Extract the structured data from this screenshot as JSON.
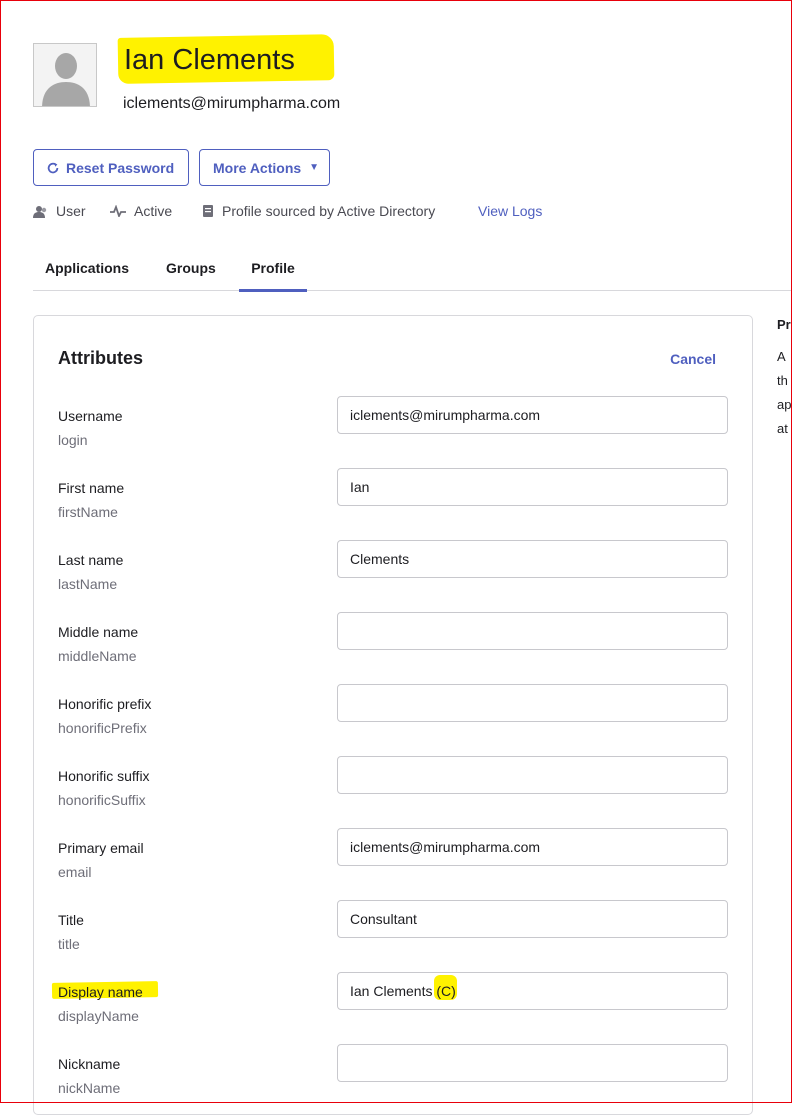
{
  "user": {
    "name": "Ian Clements",
    "email": "iclements@mirumpharma.com"
  },
  "actions": {
    "reset_password": "Reset Password",
    "more_actions": "More Actions",
    "more_caret": "▼"
  },
  "status": {
    "type": "User",
    "state": "Active",
    "source": "Profile sourced by Active Directory",
    "view_logs": "View Logs"
  },
  "tabs": [
    {
      "label": "Applications"
    },
    {
      "label": "Groups"
    },
    {
      "label": "Profile",
      "active": true
    }
  ],
  "attributes": {
    "title": "Attributes",
    "cancel": "Cancel",
    "fields": [
      {
        "label": "Username",
        "key": "login",
        "value": "iclements@mirumpharma.com"
      },
      {
        "label": "First name",
        "key": "firstName",
        "value": "Ian"
      },
      {
        "label": "Last name",
        "key": "lastName",
        "value": "Clements"
      },
      {
        "label": "Middle name",
        "key": "middleName",
        "value": ""
      },
      {
        "label": "Honorific prefix",
        "key": "honorificPrefix",
        "value": ""
      },
      {
        "label": "Honorific suffix",
        "key": "honorificSuffix",
        "value": ""
      },
      {
        "label": "Primary email",
        "key": "email",
        "value": "iclements@mirumpharma.com"
      },
      {
        "label": "Title",
        "key": "title",
        "value": "Consultant"
      },
      {
        "label": "Display name",
        "key": "displayName",
        "value": "Ian Clements (C)"
      },
      {
        "label": "Nickname",
        "key": "nickName",
        "value": ""
      }
    ]
  },
  "side_panel": {
    "lines": [
      "Pr",
      "A",
      "th",
      "ap",
      "at"
    ]
  },
  "colors": {
    "accent": "#4f5fbf",
    "highlight": "#fff200",
    "frame": "#e8000b"
  }
}
